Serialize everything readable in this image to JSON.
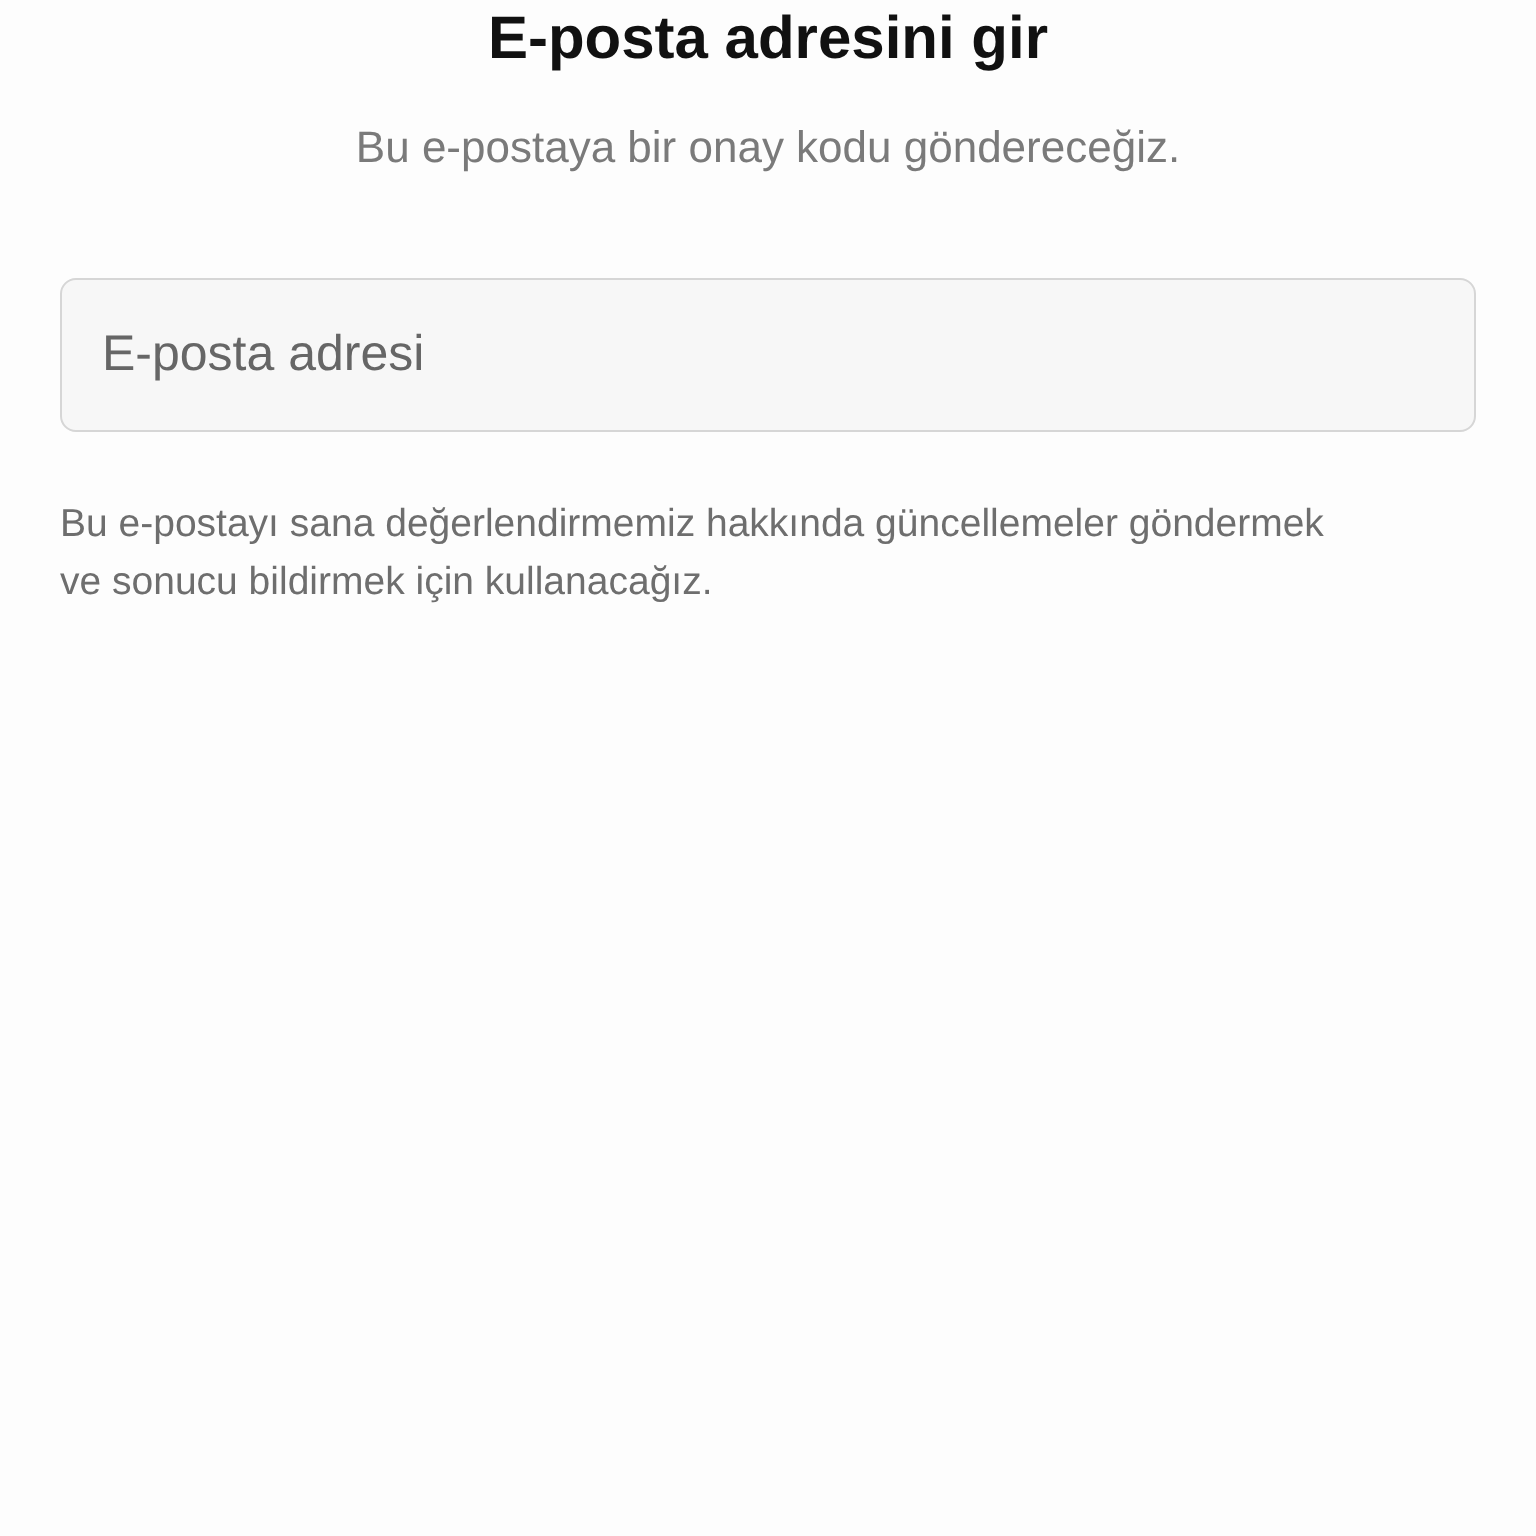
{
  "title": "E-posta adresini gir",
  "subtitle": "Bu e-postaya bir onay kodu göndereceğiz.",
  "email_field": {
    "placeholder": "E-posta adresi"
  },
  "note": "Bu e-postayı sana değerlendirmemiz hakkında güncellemeler göndermek ve sonucu bildirmek için kullanacağız."
}
